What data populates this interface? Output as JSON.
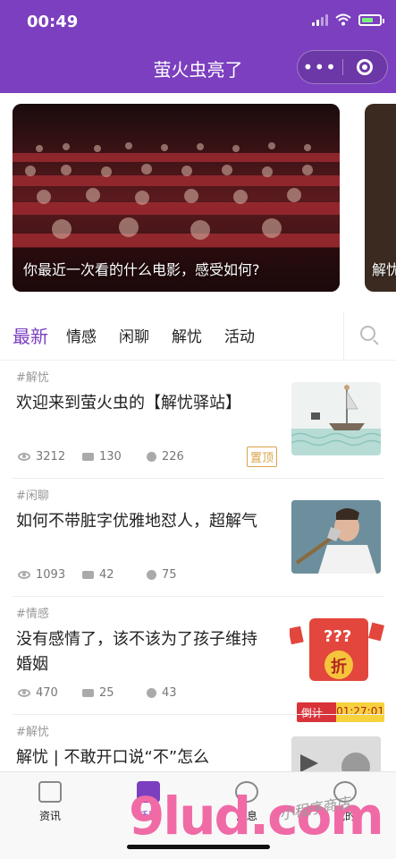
{
  "status": {
    "time": "00:49"
  },
  "nav": {
    "title": "萤火虫亮了",
    "more_glyph": "•••"
  },
  "banner": {
    "slides": [
      {
        "caption": "你最近一次看的什么电影，感受如何?"
      },
      {
        "caption": "解忧"
      }
    ]
  },
  "tabs": [
    "最新",
    "情感",
    "闲聊",
    "解忧",
    "活动"
  ],
  "posts": [
    {
      "tag": "#解忧",
      "title": "欢迎来到萤火虫的【解忧驿站】",
      "views": "3212",
      "comments": "130",
      "likes": "226",
      "badge": "置顶"
    },
    {
      "tag": "#闲聊",
      "title": "如何不带脏字优雅地怼人，超解气",
      "views": "1093",
      "comments": "42",
      "likes": "75"
    },
    {
      "tag": "#情感",
      "title": "没有感情了，该不该为了孩子维持婚姻",
      "views": "470",
      "comments": "25",
      "likes": "43"
    },
    {
      "tag": "#解忧",
      "title": "解忧 | 不敢开口说“不”怎么"
    }
  ],
  "ad": {
    "text": "???",
    "coupon": "折",
    "countdown_label": "倒计时",
    "countdown_time": "01:27:01"
  },
  "tabbar": [
    {
      "label": "资讯",
      "icon": "news-icon"
    },
    {
      "label": "话题",
      "icon": "topic-icon",
      "active": true
    },
    {
      "label": "消息",
      "icon": "message-icon"
    },
    {
      "label": "我的",
      "icon": "profile-icon"
    }
  ],
  "watermark": {
    "logo": "9lud.com",
    "sub": "小程序商店"
  },
  "colors": {
    "brand": "#7b3fbf",
    "badge": "#d9a44a",
    "countdown_red": "#d9333a",
    "countdown_yellow": "#f6d23c"
  }
}
